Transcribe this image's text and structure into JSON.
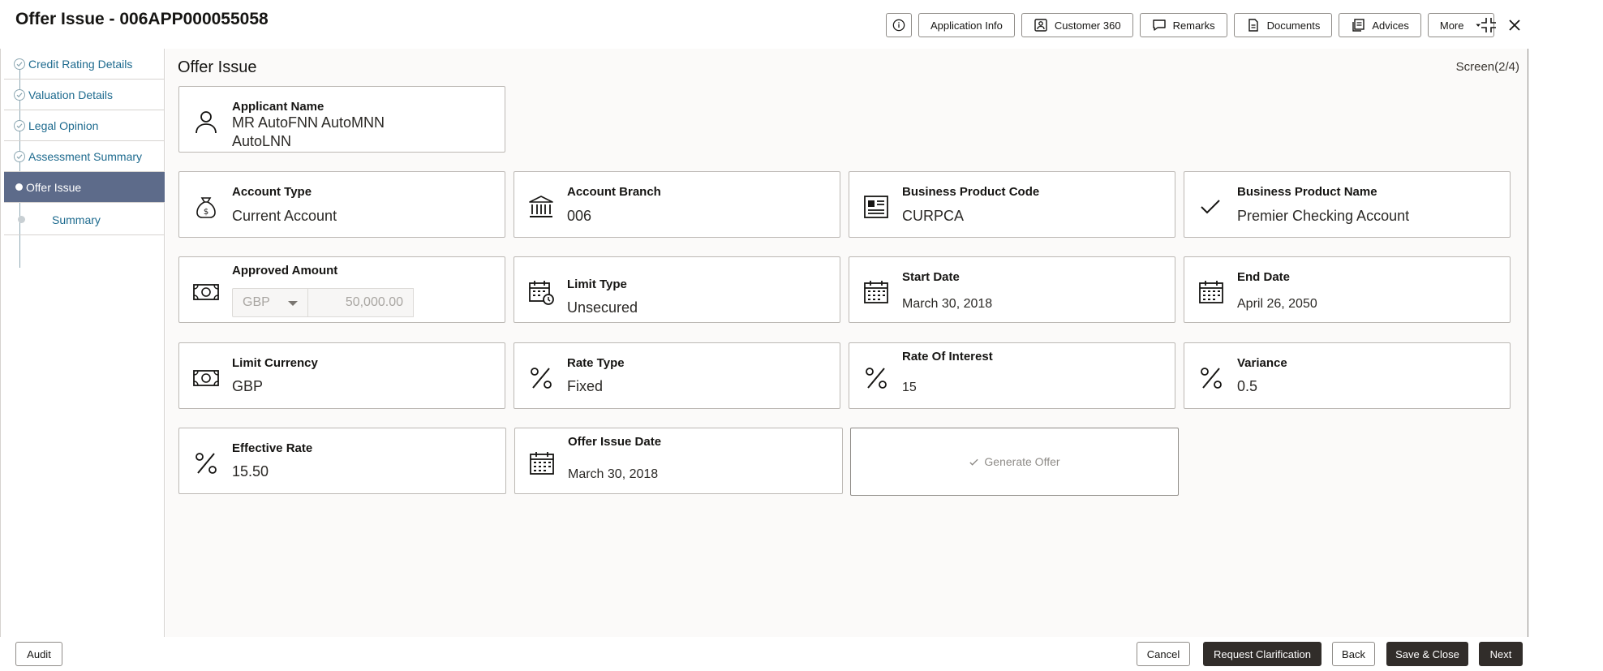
{
  "header": {
    "title": "Offer Issue - 006APP000055058",
    "buttons": {
      "application_info": "Application Info",
      "customer_360": "Customer 360",
      "remarks": "Remarks",
      "documents": "Documents",
      "advices": "Advices",
      "more": "More"
    }
  },
  "sidebar": {
    "items": [
      {
        "label": "Credit Rating Details",
        "state": "done"
      },
      {
        "label": "Valuation Details",
        "state": "done"
      },
      {
        "label": "Legal Opinion",
        "state": "done"
      },
      {
        "label": "Assessment Summary",
        "state": "done"
      },
      {
        "label": "Offer Issue",
        "state": "active"
      },
      {
        "label": "Summary",
        "state": "upcoming"
      }
    ]
  },
  "main": {
    "title": "Offer Issue",
    "screen_indicator": "Screen(2/4)",
    "applicant": {
      "label": "Applicant Name",
      "value_line1": "MR AutoFNN AutoMNN",
      "value_line2": "AutoLNN"
    },
    "account_type": {
      "label": "Account Type",
      "value": "Current Account"
    },
    "account_branch": {
      "label": "Account Branch",
      "value": "006"
    },
    "business_product_code": {
      "label": "Business Product Code",
      "value": "CURPCA"
    },
    "business_product_name": {
      "label": "Business Product Name",
      "value": "Premier Checking Account"
    },
    "approved_amount": {
      "label": "Approved Amount",
      "currency": "GBP",
      "amount": "50,000.00"
    },
    "limit_type": {
      "label": "Limit Type",
      "value": "Unsecured"
    },
    "start_date": {
      "label": "Start Date",
      "value": "March 30, 2018"
    },
    "end_date": {
      "label": "End Date",
      "value": "April 26, 2050"
    },
    "limit_currency": {
      "label": "Limit Currency",
      "value": "GBP"
    },
    "rate_type": {
      "label": "Rate Type",
      "value": "Fixed"
    },
    "rate_of_interest": {
      "label": "Rate Of Interest",
      "value": "15"
    },
    "variance": {
      "label": "Variance",
      "value": "0.5"
    },
    "effective_rate": {
      "label": "Effective Rate",
      "value": "15.50"
    },
    "offer_issue_date": {
      "label": "Offer Issue Date",
      "value": "March 30, 2018"
    },
    "generate_offer": "Generate Offer"
  },
  "footer": {
    "audit": "Audit",
    "cancel": "Cancel",
    "request_clarification": "Request Clarification",
    "back": "Back",
    "save_close": "Save & Close",
    "next": "Next"
  },
  "colors": {
    "accent_link": "#1d6a8e",
    "active_step": "#5d6b8a",
    "primary_button": "#312d2a"
  }
}
